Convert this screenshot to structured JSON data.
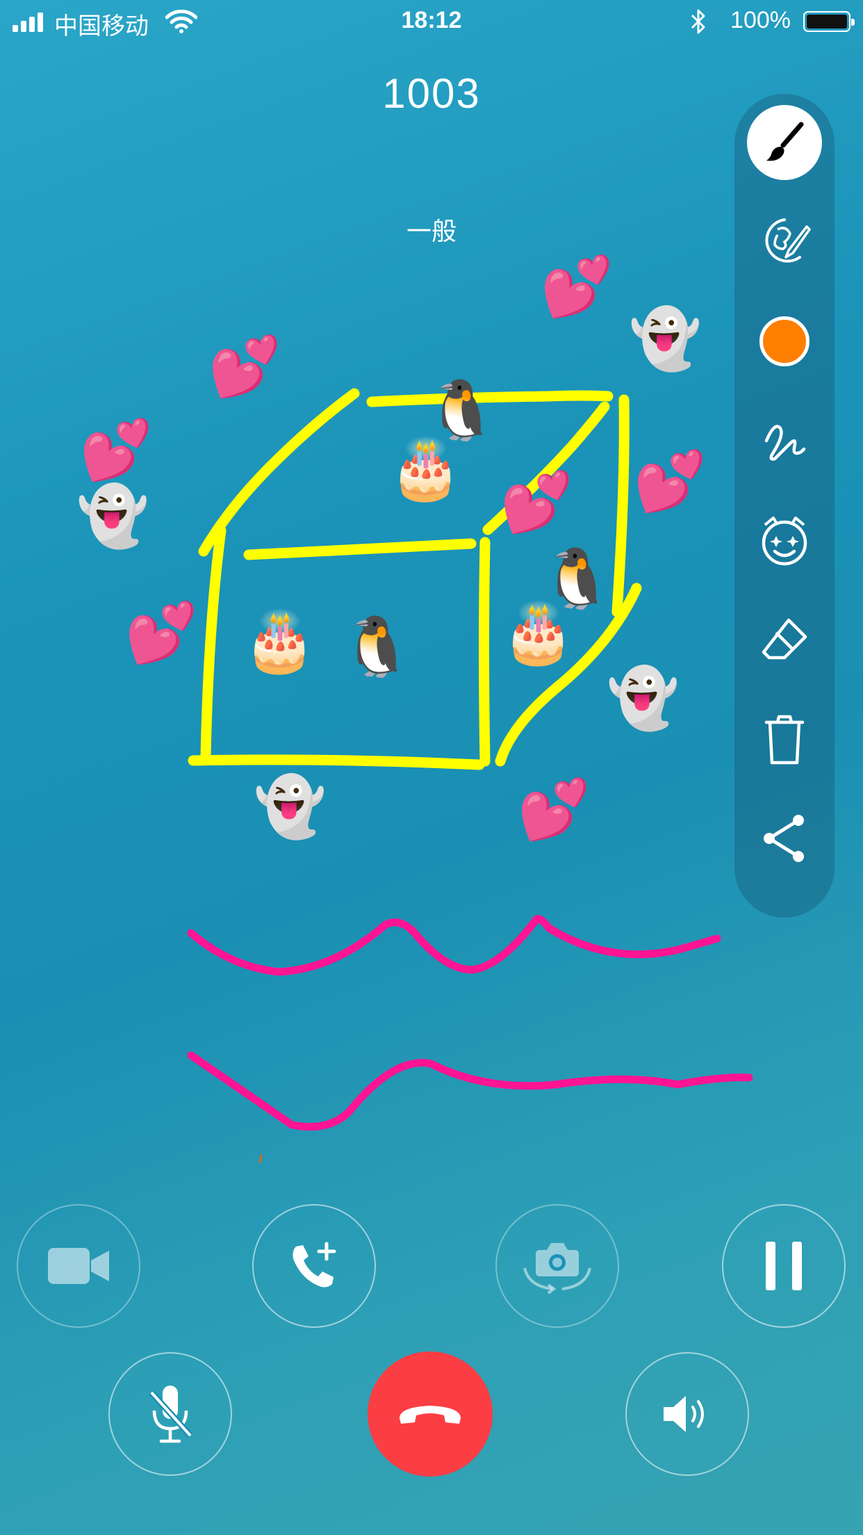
{
  "status_bar": {
    "carrier": "中国移动",
    "time": "18:12",
    "battery": "100%"
  },
  "call": {
    "number": "1003",
    "quality": "一般"
  },
  "colors": {
    "pen_color": "#ff7f00",
    "stroke_yellow": "#ffff00",
    "stroke_pink": "#ff1493",
    "hangup": "#fb3d44"
  },
  "toolbar": {
    "tools": [
      "brush-icon",
      "portrait-brush-icon",
      "color-swatch",
      "freehand-stroke-icon",
      "sticker-face-icon",
      "eraser-icon",
      "trash-icon",
      "share-icon"
    ],
    "active": "brush-icon"
  },
  "stickers": {
    "ghost": "👻",
    "cake": "🎂",
    "penguin": "🐧",
    "hearts": "💕"
  },
  "controls": {
    "row1": [
      "video-camera-button",
      "add-call-button",
      "switch-camera-button",
      "hold-button"
    ],
    "row2": [
      "mute-button",
      "hang-up-button",
      "speaker-button"
    ]
  }
}
